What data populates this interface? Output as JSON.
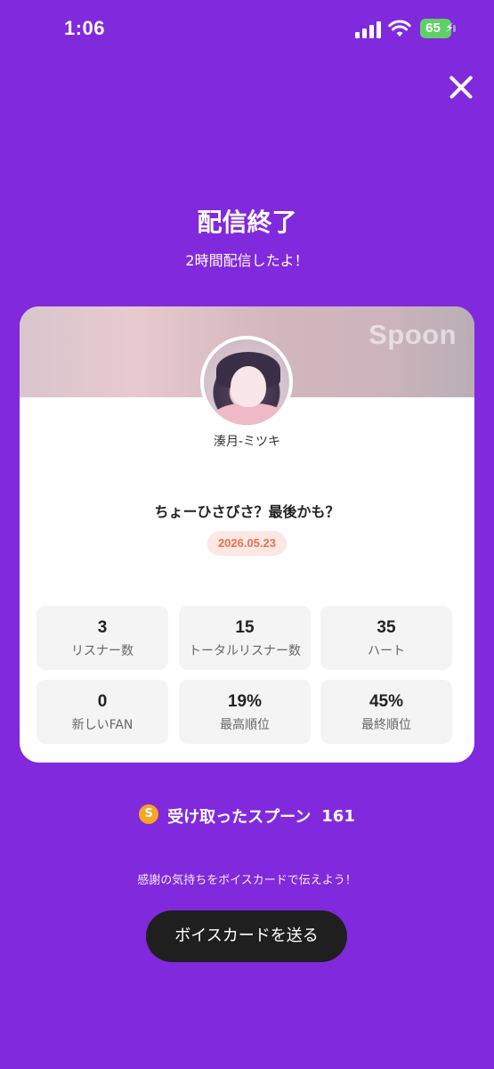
{
  "status_bar": {
    "time": "1:06",
    "battery": "65",
    "icons": [
      "signal-icon",
      "wifi-icon",
      "battery-icon"
    ]
  },
  "header": {
    "close_icon": "close-icon",
    "title": "配信終了",
    "subtitle": "2時間配信したよ！"
  },
  "card": {
    "brand": "Spoon",
    "username": "湊月-ミツキ",
    "broadcast_title": "ちょーひさびさ？最後かも？",
    "date": "2026.05.23",
    "stats": [
      {
        "value": "3",
        "label": "リスナー数"
      },
      {
        "value": "15",
        "label": "トータルリスナー数"
      },
      {
        "value": "35",
        "label": "ハート"
      },
      {
        "value": "0",
        "label": "新しいFAN"
      },
      {
        "value": "19%",
        "label": "最高順位"
      },
      {
        "value": "45%",
        "label": "最終順位"
      }
    ]
  },
  "spoons": {
    "icon": "spoon-coin-icon",
    "icon_glyph": "S",
    "label": "受け取ったスプーン",
    "count": "161"
  },
  "footer": {
    "thanks_text": "感謝の気持ちをボイスカードで伝えよう！",
    "button_label": "ボイスカードを送る"
  },
  "colors": {
    "background": "#8129dc",
    "date_badge_text": "#e8724d",
    "button_bg": "#1f1f1f"
  }
}
